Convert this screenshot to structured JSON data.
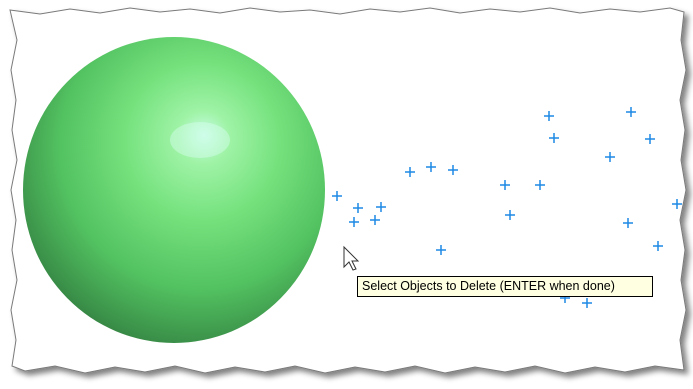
{
  "colors": {
    "viewport_background": "#ffffff",
    "point_marker": "#1e88e5",
    "sphere_highlight": "#c8fbe6",
    "sphere_light": "#7fe680",
    "sphere_mid": "#4fbf5f",
    "sphere_dark": "#2a6a36",
    "tooltip_background": "#ffffe1",
    "tooltip_border": "#000000"
  },
  "viewport": {
    "objects": [
      "sphere",
      "point-markers"
    ],
    "cursor_icon": "arrow-cursor-icon"
  },
  "tooltip": {
    "text": "Select Objects to Delete (ENTER when done)"
  }
}
